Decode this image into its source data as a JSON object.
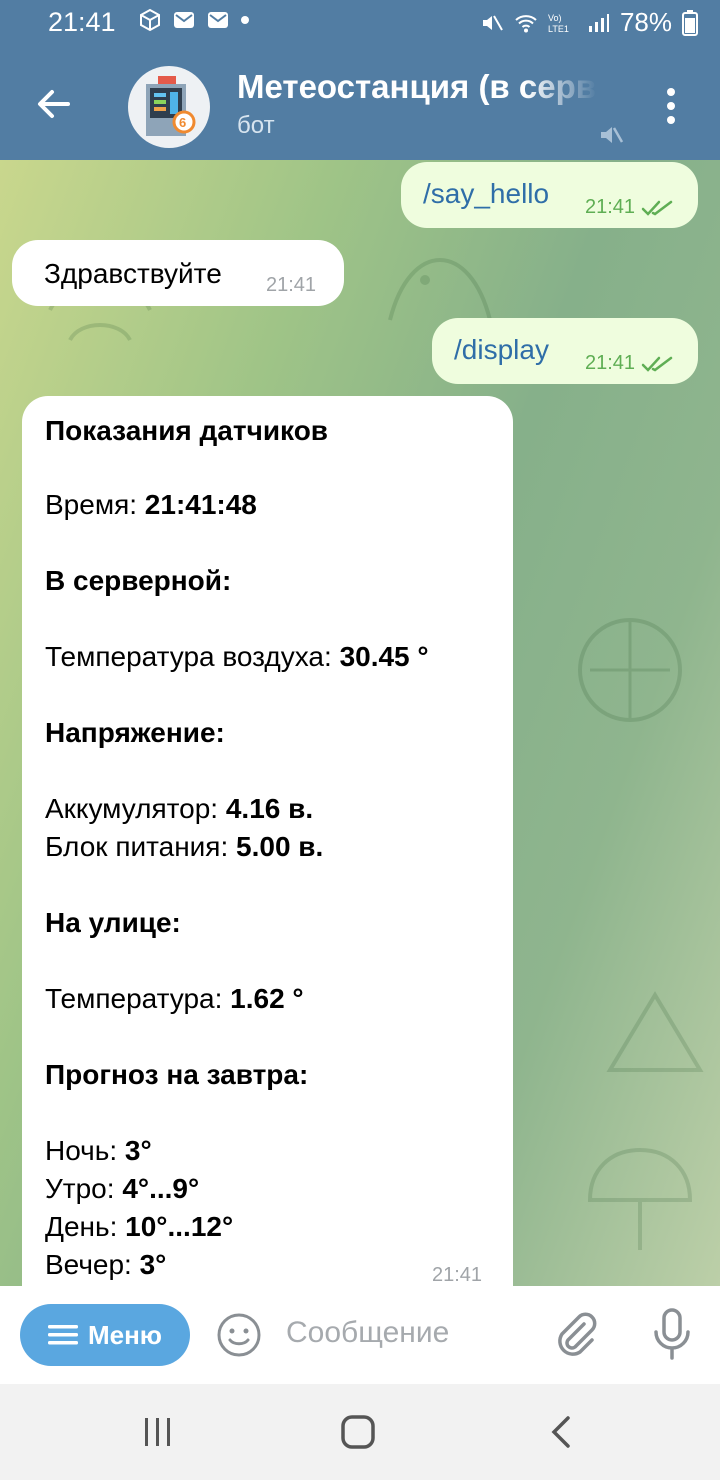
{
  "status_bar": {
    "time": "21:41",
    "battery": "78%"
  },
  "header": {
    "title": "Метеостанция (в серверной)",
    "subtitle": "бот"
  },
  "messages": [
    {
      "text": "/say_hello",
      "time": "21:41"
    },
    {
      "text": "Здравствуйте",
      "time": "21:41"
    },
    {
      "text": "/display",
      "time": "21:41"
    }
  ],
  "report": {
    "heading": "Показания датчиков",
    "time_label": "Время: ",
    "time_value": "21:41:48",
    "server_heading": "В серверной:",
    "air_label": "Температура воздуха: ",
    "air_value": "30.45 °",
    "voltage_heading": "Напряжение:",
    "battery_label": "Аккумулятор: ",
    "battery_value": "4.16 в.",
    "psu_label": "Блок питания: ",
    "psu_value": "5.00 в.",
    "outside_heading": "На улице:",
    "temp_label": "Температура: ",
    "temp_value": "1.62 °",
    "forecast_heading": "Прогноз на завтра:",
    "night_label": "Ночь: ",
    "night_value": "3°",
    "morning_label": "Утро: ",
    "morning_value": "4°...9°",
    "day_label": "День: ",
    "day_value": "10°...12°",
    "evening_label": "Вечер: ",
    "evening_value": "3°",
    "timestamp": "21:41"
  },
  "input": {
    "menu_label": "Меню",
    "placeholder": "Сообщение"
  },
  "colors": {
    "header": "#527da3",
    "outgoing_bubble": "#effdde",
    "incoming_bubble": "#ffffff",
    "menu_button": "#5aa7e0"
  },
  "icons": [
    "back-arrow-icon",
    "muted-speaker-icon",
    "more-vertical-icon",
    "double-check-icon",
    "emoji-icon",
    "attach-icon",
    "mic-icon"
  ]
}
